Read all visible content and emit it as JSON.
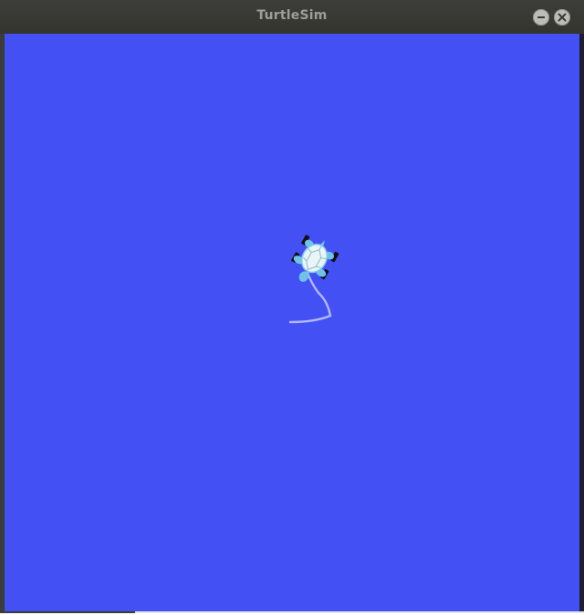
{
  "window": {
    "title": "TurtleSim",
    "buttons": {
      "minimize": "minimize-icon",
      "close": "close-icon"
    }
  },
  "simulation": {
    "background_color": "#4350f4",
    "pen_color": "#b3b8ff",
    "turtle": {
      "shell_color": "#e9f4f6",
      "limb_color": "#6fc3e8",
      "foot_color": "#111111"
    }
  }
}
